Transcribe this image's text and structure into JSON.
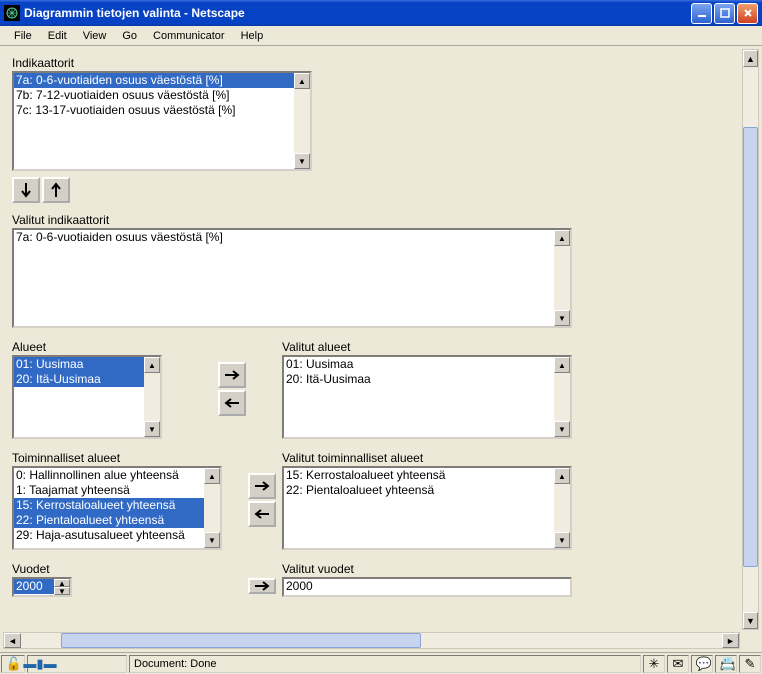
{
  "window": {
    "title": "Diagrammin tietojen valinta - Netscape"
  },
  "menu": {
    "file": "File",
    "edit": "Edit",
    "view": "View",
    "go": "Go",
    "communicator": "Communicator",
    "help": "Help"
  },
  "labels": {
    "indikaattorit": "Indikaattorit",
    "valitut_indikaattorit": "Valitut indikaattorit",
    "alueet": "Alueet",
    "valitut_alueet": "Valitut alueet",
    "toiminnalliset": "Toiminnalliset alueet",
    "valitut_toiminnalliset": "Valitut toiminnalliset alueet",
    "vuodet": "Vuodet",
    "valitut_vuodet": "Valitut vuodet"
  },
  "indikaattorit": [
    "7a: 0-6-vuotiaiden osuus väestöstä [%]",
    "7b: 7-12-vuotiaiden osuus väestöstä [%]",
    "7c: 13-17-vuotiaiden osuus väestöstä [%]"
  ],
  "valitut_indikaattorit": [
    "7a: 0-6-vuotiaiden osuus väestöstä [%]"
  ],
  "alueet": [
    "01: Uusimaa",
    "20: Itä-Uusimaa"
  ],
  "valitut_alueet": [
    "01: Uusimaa",
    "20: Itä-Uusimaa"
  ],
  "toiminnalliset": [
    "0: Hallinnollinen alue yhteensä",
    "1: Taajamat yhteensä",
    "15: Kerrostaloalueet yhteensä",
    "22: Pientaloalueet yhteensä",
    "29: Haja-asutusalueet yhteensä"
  ],
  "valitut_toiminnalliset": [
    "15: Kerrostaloalueet yhteensä",
    "22: Pientaloalueet yhteensä"
  ],
  "vuodet": [
    "2000"
  ],
  "valitut_vuodet": [
    "2000"
  ],
  "status": {
    "text": "Document: Done"
  }
}
